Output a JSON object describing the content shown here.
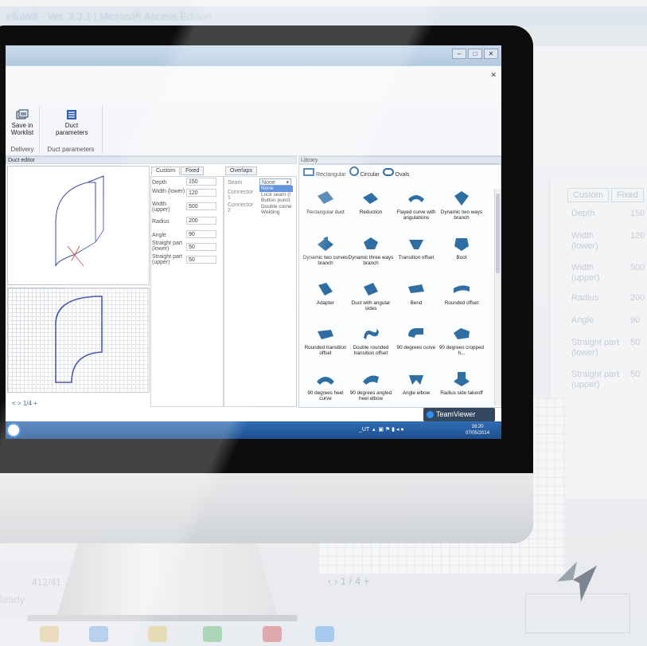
{
  "background_app": {
    "title": "ellula® - Ver. 3.3.1 | Microsoft Access Edition",
    "tabs": [
      "Custom",
      "Fixed"
    ],
    "params": [
      {
        "label": "Depth",
        "value": "150"
      },
      {
        "label": "Width (lower)",
        "value": "120"
      },
      {
        "label": "Width (upper)",
        "value": "500"
      },
      {
        "label": "Radius",
        "value": "200"
      },
      {
        "label": "Angle",
        "value": "90"
      },
      {
        "label": "Straight part (lower)",
        "value": "50"
      },
      {
        "label": "Straight part (upper)",
        "value": "50"
      }
    ],
    "record_count": "412/41",
    "pager": "1 / 4",
    "status": "leady"
  },
  "app": {
    "ribbon": {
      "save_worklist": "Save in Worklist",
      "delivery_group": "Delivery",
      "duct_params": "Duct parameters",
      "duct_params_group": "Duct parameters"
    },
    "duct_editor_label": "Duct editor",
    "tabs": {
      "custom": "Custom",
      "fixed": "Fixed",
      "overlaps": "Overlaps"
    },
    "params": [
      {
        "label": "Depth",
        "value": "150"
      },
      {
        "label": "Width (lower)",
        "value": "120"
      },
      {
        "label": "Width (upper)",
        "value": "500"
      },
      {
        "label": "Radius",
        "value": "200"
      },
      {
        "label": "Angle",
        "value": "90"
      },
      {
        "label": "Straight part (lower)",
        "value": "50"
      },
      {
        "label": "Straight part (upper)",
        "value": "50"
      }
    ],
    "overlaps": {
      "seam": "Seam",
      "connector1": "Connector 1",
      "connector2": "Connector 2",
      "selected": "None",
      "options": [
        "None",
        "Lock seam (l",
        "Button punct",
        "Double corne",
        "Welding"
      ]
    },
    "library": {
      "title": "Library",
      "tabs": [
        "Rectangular",
        "Circular",
        "Ovals"
      ],
      "items": [
        "Rectangular duct",
        "Reduction",
        "Flayed curve with angulations",
        "Dynamic two ways branch",
        "Dynamic two curves branch",
        "Dynamic three ways branch",
        "Transition offset",
        "Boot",
        "Adapter",
        "Duct with angular sides",
        "Bend",
        "Rounded offset",
        "Rounded transition offset",
        "Double rounded transition offset",
        "90 degrees curve",
        "90 degrees cropped h...",
        "90 degrees heel curve",
        "90 degrees angled heel elbow",
        "Angle elbow",
        "Radius side takeoff"
      ]
    },
    "pager": "1/4",
    "teamviewer": "TeamViewer",
    "tray_text": "_UT",
    "clock_time": "16:20",
    "clock_date": "07/05/2014"
  },
  "colors": {
    "shape_blue": "#2f6ea3",
    "drawing_blue": "#1a2b9c",
    "taskbar": "#1d4f8e"
  }
}
